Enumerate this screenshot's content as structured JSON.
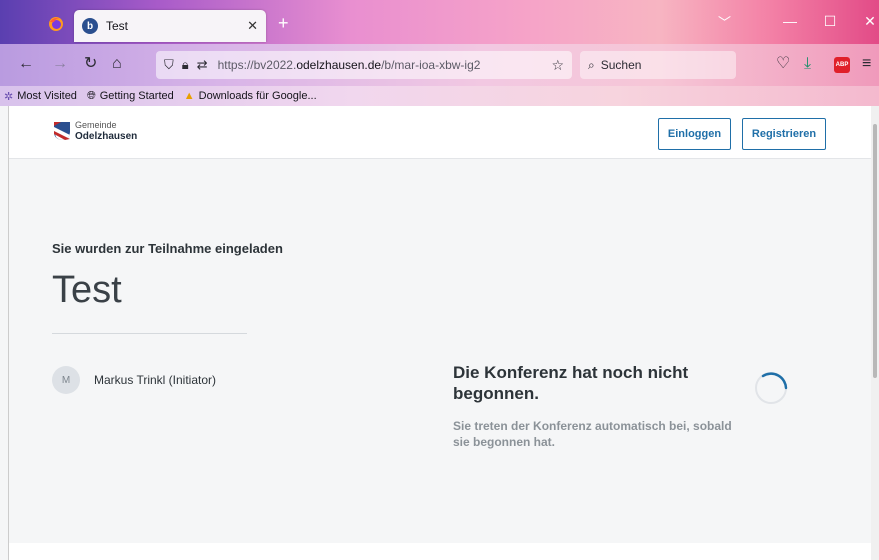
{
  "browser": {
    "tab_title": "Test",
    "tab_favicon_letter": "b",
    "new_tab_label": "+",
    "url_prefix": "https://bv2022.",
    "url_domain": "odelzhausen.de",
    "url_path": "/b/mar-ioa-xbw-ig2",
    "search_placeholder": "Suchen",
    "adblock_label": "ABP",
    "bookmarks": [
      {
        "label": "Most Visited",
        "icon": "gear-icon"
      },
      {
        "label": "Getting Started",
        "icon": "globe-icon"
      },
      {
        "label": "Downloads für Google...",
        "icon": "drive-icon"
      }
    ]
  },
  "header": {
    "logo_small": "Gemeinde",
    "logo_big": "Odelzhausen",
    "login_label": "Einloggen",
    "register_label": "Registrieren"
  },
  "main": {
    "invited_text": "Sie wurden zur Teilnahme eingeladen",
    "room_title": "Test",
    "participant_initial": "M",
    "participant_name": "Markus Trinkl (Initiator)",
    "status_title": "Die Konferenz hat noch nicht begonnen.",
    "status_subtitle": "Sie treten der Konferenz automatisch bei, sobald sie begonnen hat."
  },
  "colors": {
    "accent": "#1f6fa8",
    "text": "#2d3439",
    "muted": "#8b9298"
  }
}
